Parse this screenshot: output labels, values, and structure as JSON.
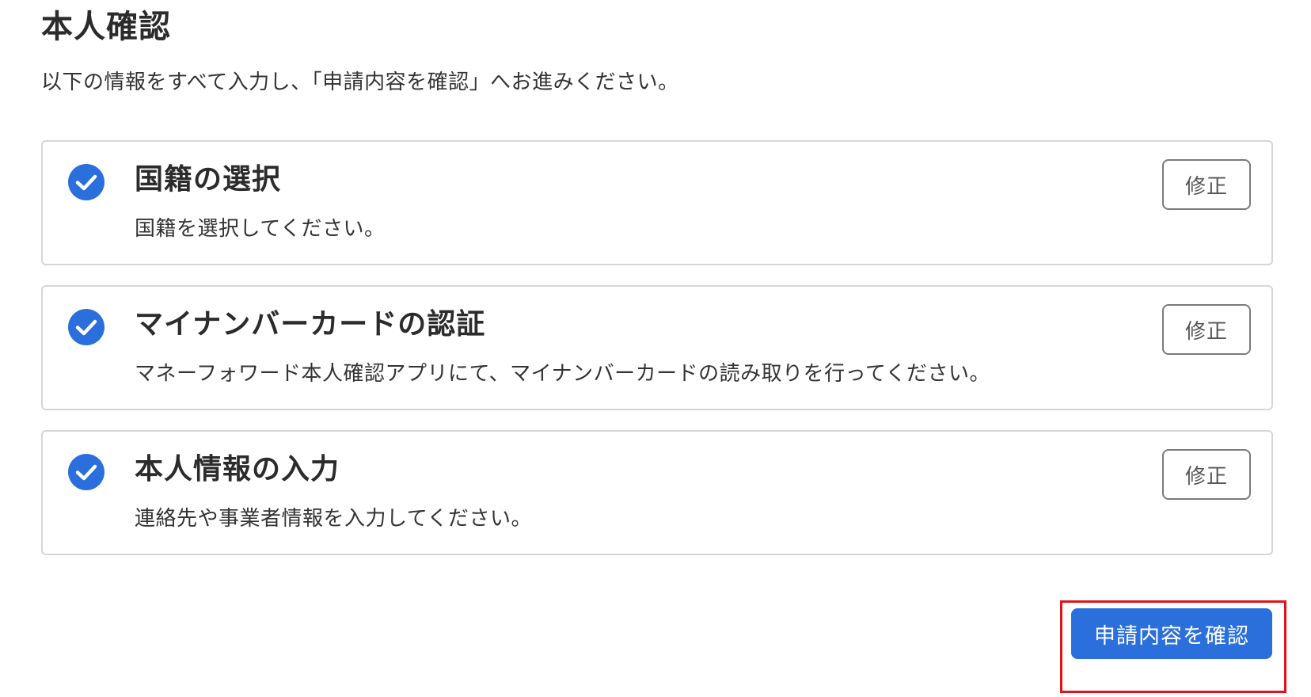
{
  "page": {
    "title": "本人確認",
    "instructions": "以下の情報をすべて入力し、「申請内容を確認」へお進みください。"
  },
  "steps": [
    {
      "title": "国籍の選択",
      "description": "国籍を選択してください。",
      "status_icon": "check-circle-icon",
      "edit_label": "修正"
    },
    {
      "title": "マイナンバーカードの認証",
      "description": "マネーフォワード本人確認アプリにて、マイナンバーカードの読み取りを行ってください。",
      "status_icon": "check-circle-icon",
      "edit_label": "修正"
    },
    {
      "title": "本人情報の入力",
      "description": "連絡先や事業者情報を入力してください。",
      "status_icon": "check-circle-icon",
      "edit_label": "修正"
    }
  ],
  "actions": {
    "confirm_label": "申請内容を確認"
  },
  "colors": {
    "accent": "#2a6fdb",
    "check": "#2a6fdb",
    "highlight": "#e0141e",
    "card_border": "#d6d6d6"
  }
}
